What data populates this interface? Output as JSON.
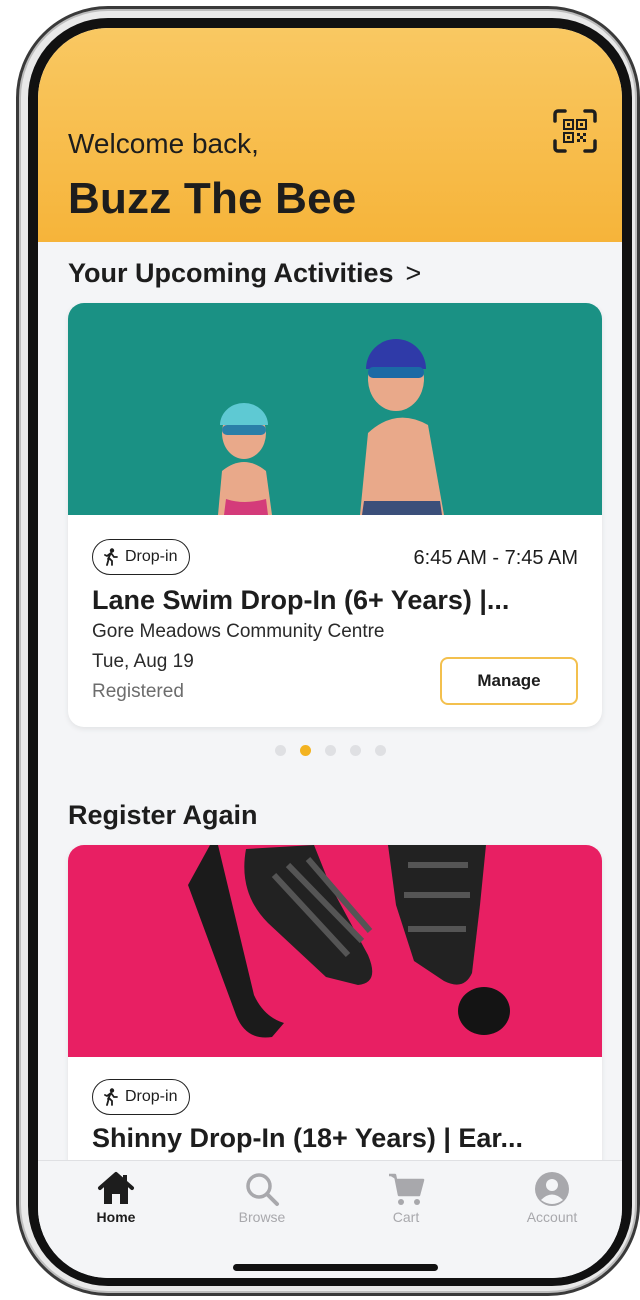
{
  "header": {
    "welcome": "Welcome back,",
    "username": "Buzz The Bee",
    "qr_icon": "qr-code-scan-icon"
  },
  "upcoming": {
    "title": "Your Upcoming Activities",
    "chevron": ">",
    "card": {
      "tag": "Drop-in",
      "time": "6:45 AM - 7:45 AM",
      "title": "Lane Swim Drop-In (6+ Years) |...",
      "location": "Gore Meadows Community Centre",
      "date": "Tue, Aug 19",
      "status": "Registered",
      "manage_label": "Manage",
      "image_color": "#1a9184"
    },
    "pager": {
      "count": 5,
      "active_index": 1
    }
  },
  "register_again": {
    "title": "Register Again",
    "card": {
      "tag": "Drop-in",
      "title": "Shinny Drop-In (18+ Years) | Ear...",
      "image_color": "#e81f63"
    }
  },
  "tabbar": {
    "items": [
      {
        "label": "Home",
        "icon": "home-icon",
        "active": true
      },
      {
        "label": "Browse",
        "icon": "search-icon",
        "active": false
      },
      {
        "label": "Cart",
        "icon": "cart-icon",
        "active": false
      },
      {
        "label": "Account",
        "icon": "account-icon",
        "active": false
      }
    ]
  },
  "colors": {
    "header_top": "#f9c862",
    "header_bottom": "#f6b43a",
    "accent": "#f3b321",
    "manage_border": "#f3c04e"
  }
}
